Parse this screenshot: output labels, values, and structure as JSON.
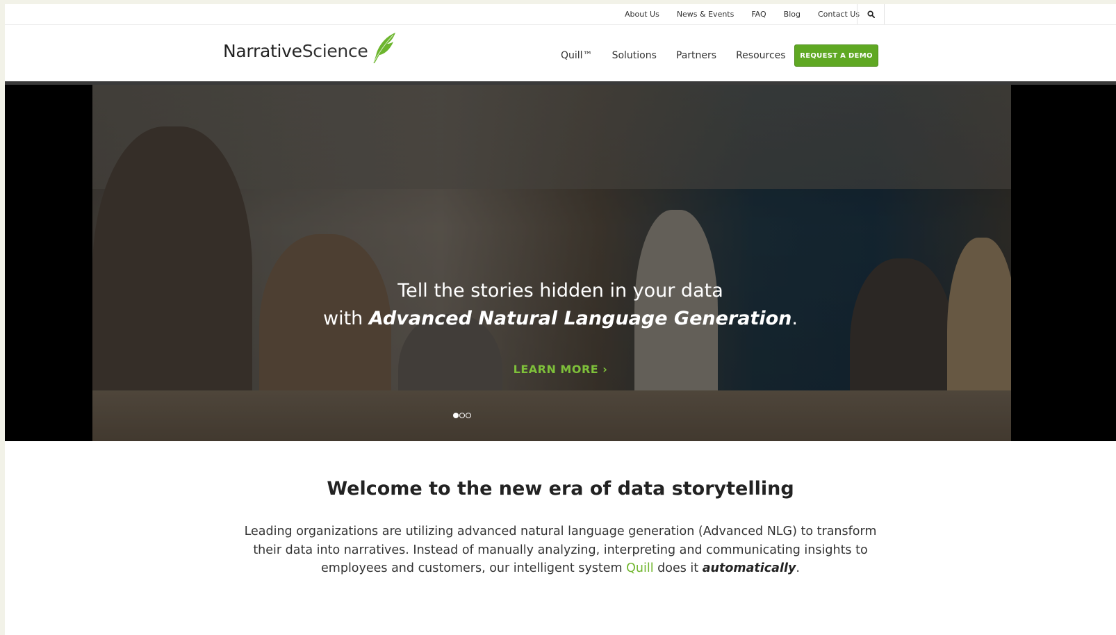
{
  "utility_nav": {
    "items": [
      {
        "label": "About Us"
      },
      {
        "label": "News & Events"
      },
      {
        "label": "FAQ"
      },
      {
        "label": "Blog"
      },
      {
        "label": "Contact Us"
      }
    ],
    "search_icon": "search-icon"
  },
  "header": {
    "logo": {
      "part1": "Narrative",
      "part2": "Science",
      "icon": "feather-quill-icon",
      "icon_color": "#6cb52d"
    },
    "nav": [
      {
        "label": "Quill™"
      },
      {
        "label": "Solutions"
      },
      {
        "label": "Partners"
      },
      {
        "label": "Resources"
      }
    ],
    "cta": {
      "label": "REQUEST A DEMO",
      "color": "#5fa823"
    }
  },
  "hero": {
    "line1": "Tell the stories hidden in your data",
    "line2_prefix": "with ",
    "line2_emphasis": "Advanced Natural Language Generation",
    "line2_suffix": ".",
    "cta": "LEARN MORE ›",
    "cta_color": "#7ec03a",
    "slides": {
      "count": 3,
      "active": 1
    }
  },
  "welcome": {
    "title": "Welcome to the new era of data storytelling",
    "body_part1": "Leading organizations are utilizing advanced natural language generation (Advanced NLG) to transform their data into narratives. Instead of manually analyzing, interpreting and communicating insights to employees and customers, our intelligent system ",
    "body_link": "Quill",
    "body_part2": " does it ",
    "body_emphasis": "automatically",
    "body_end": ".",
    "accent_color": "#6fb52c"
  }
}
